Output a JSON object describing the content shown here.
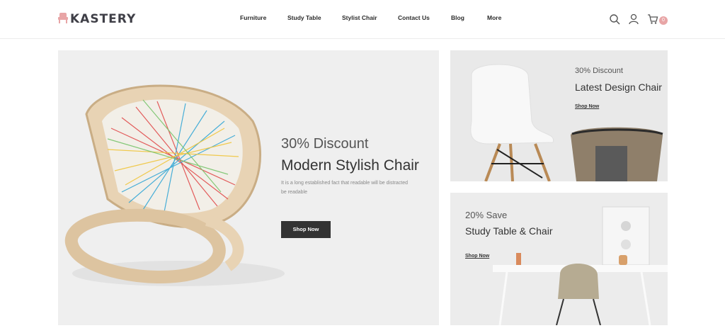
{
  "brand": {
    "name": "KASTERY",
    "accent": "#e8a5a6"
  },
  "nav": {
    "items": [
      {
        "label": "Furniture"
      },
      {
        "label": "Study Table"
      },
      {
        "label": "Stylist Chair"
      },
      {
        "label": "Contact Us"
      },
      {
        "label": "Blog"
      },
      {
        "label": "More"
      }
    ]
  },
  "header_icons": {
    "search": "search-icon",
    "account": "user-icon",
    "cart": "cart-icon",
    "cart_count": "0"
  },
  "hero": {
    "discount": "30% Discount",
    "title": "Modern Stylish Chair",
    "description": "It is a long established fact that readable will be distracted be  readable",
    "button": "Shop Now"
  },
  "banners": [
    {
      "discount": "30% Discount",
      "title": "Latest Design Chair",
      "link": "Shop Now"
    },
    {
      "discount": "20% Save",
      "title": "Study Table & Chair",
      "link": "Shop Now"
    }
  ]
}
